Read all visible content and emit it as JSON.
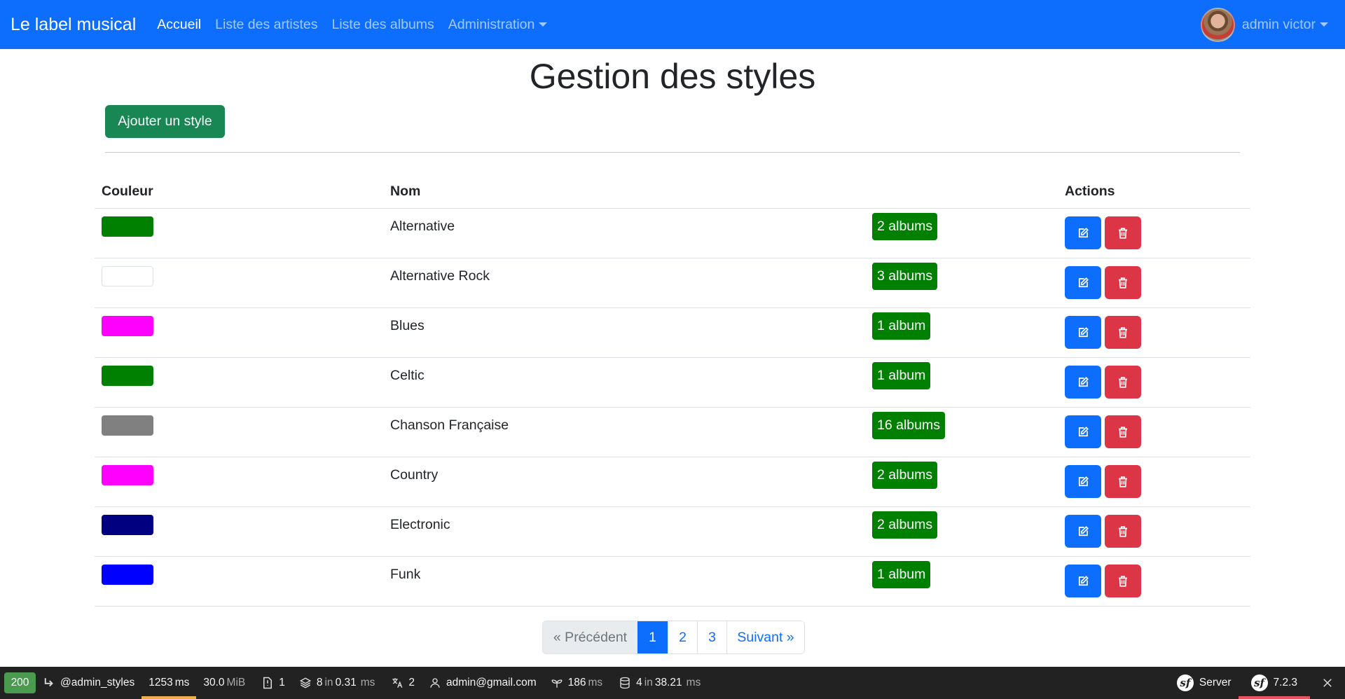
{
  "navbar": {
    "brand": "Le label musical",
    "links": [
      {
        "label": "Accueil",
        "active": true
      },
      {
        "label": "Liste des artistes",
        "active": false
      },
      {
        "label": "Liste des albums",
        "active": false
      },
      {
        "label": "Administration",
        "active": false
      }
    ],
    "user": "admin victor"
  },
  "page": {
    "title": "Gestion des styles",
    "add_button": "Ajouter un style"
  },
  "table": {
    "headers": {
      "couleur": "Couleur",
      "nom": "Nom",
      "albums": "",
      "actions": "Actions"
    },
    "rows": [
      {
        "color": "#008000",
        "name": "Alternative",
        "albums": "2 albums"
      },
      {
        "color": "#ffffff",
        "name": "Alternative Rock",
        "albums": "3 albums"
      },
      {
        "color": "#ff00ff",
        "name": "Blues",
        "albums": "1 album"
      },
      {
        "color": "#008000",
        "name": "Celtic",
        "albums": "1 album"
      },
      {
        "color": "#808080",
        "name": "Chanson Française",
        "albums": "16 albums"
      },
      {
        "color": "#ff00ff",
        "name": "Country",
        "albums": "2 albums"
      },
      {
        "color": "#000080",
        "name": "Electronic",
        "albums": "2 albums"
      },
      {
        "color": "#0000ff",
        "name": "Funk",
        "albums": "1 album"
      }
    ]
  },
  "pagination": {
    "previous": "« Précédent",
    "pages": [
      "1",
      "2",
      "3"
    ],
    "current": "1",
    "next": "Suivant »"
  },
  "toolbar": {
    "status": "200",
    "route": "@admin_styles",
    "time_value": "1253",
    "time_unit": "ms",
    "memory_value": "30.0",
    "memory_unit": "MiB",
    "logs": "1",
    "twig_count": "8",
    "twig_in": "in",
    "twig_time": "0.31",
    "twig_unit": "ms",
    "translations": "2",
    "user": "admin@gmail.com",
    "cache_value": "186",
    "cache_unit": "ms",
    "db_count": "4",
    "db_in": "in",
    "db_time": "38.21",
    "db_unit": "ms",
    "server": "Server",
    "version": "7.2.3"
  },
  "colors": {
    "primary": "#0d6efd",
    "success": "#198754",
    "danger": "#dc3545",
    "badge": "#008000"
  }
}
